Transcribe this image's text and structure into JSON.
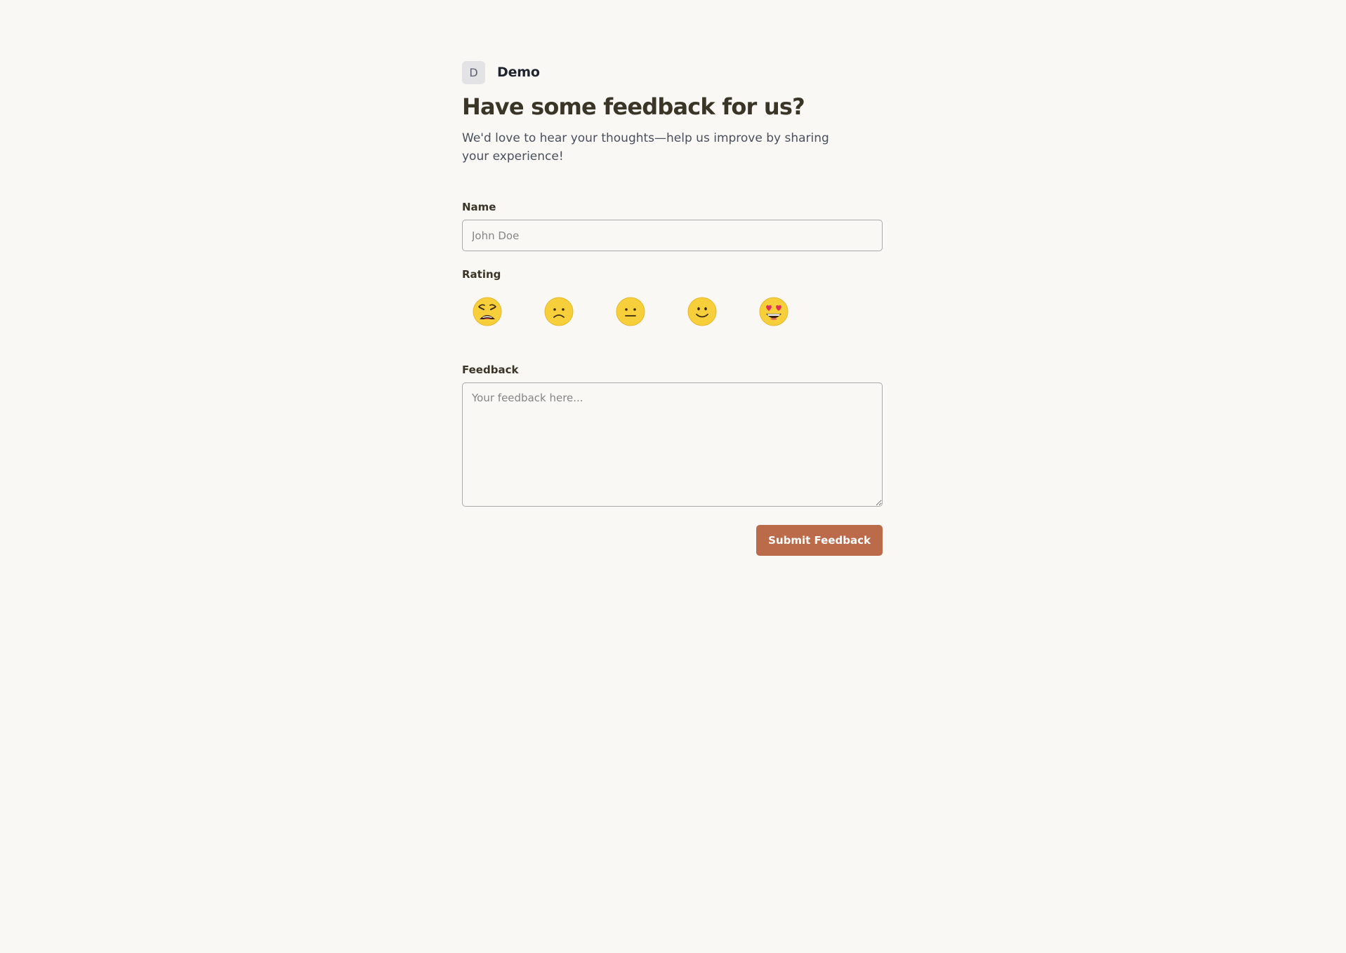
{
  "brand": {
    "avatar_letter": "D",
    "name": "Demo"
  },
  "title": "Have some feedback for us?",
  "subtitle": "We'd love to hear your thoughts—help us improve by sharing your experience!",
  "form": {
    "name_label": "Name",
    "name_placeholder": "John Doe",
    "rating_label": "Rating",
    "rating_options": [
      {
        "icon": "weary-face-icon",
        "value": 1
      },
      {
        "icon": "sad-face-icon",
        "value": 2
      },
      {
        "icon": "neutral-face-icon",
        "value": 3
      },
      {
        "icon": "smiling-face-icon",
        "value": 4
      },
      {
        "icon": "heart-eyes-face-icon",
        "value": 5
      }
    ],
    "feedback_label": "Feedback",
    "feedback_placeholder": "Your feedback here...",
    "submit_label": "Submit Feedback"
  },
  "colors": {
    "background": "#f9f8f5",
    "accent": "#bb6b4a",
    "emoji_yellow": "#f7cf3a"
  }
}
